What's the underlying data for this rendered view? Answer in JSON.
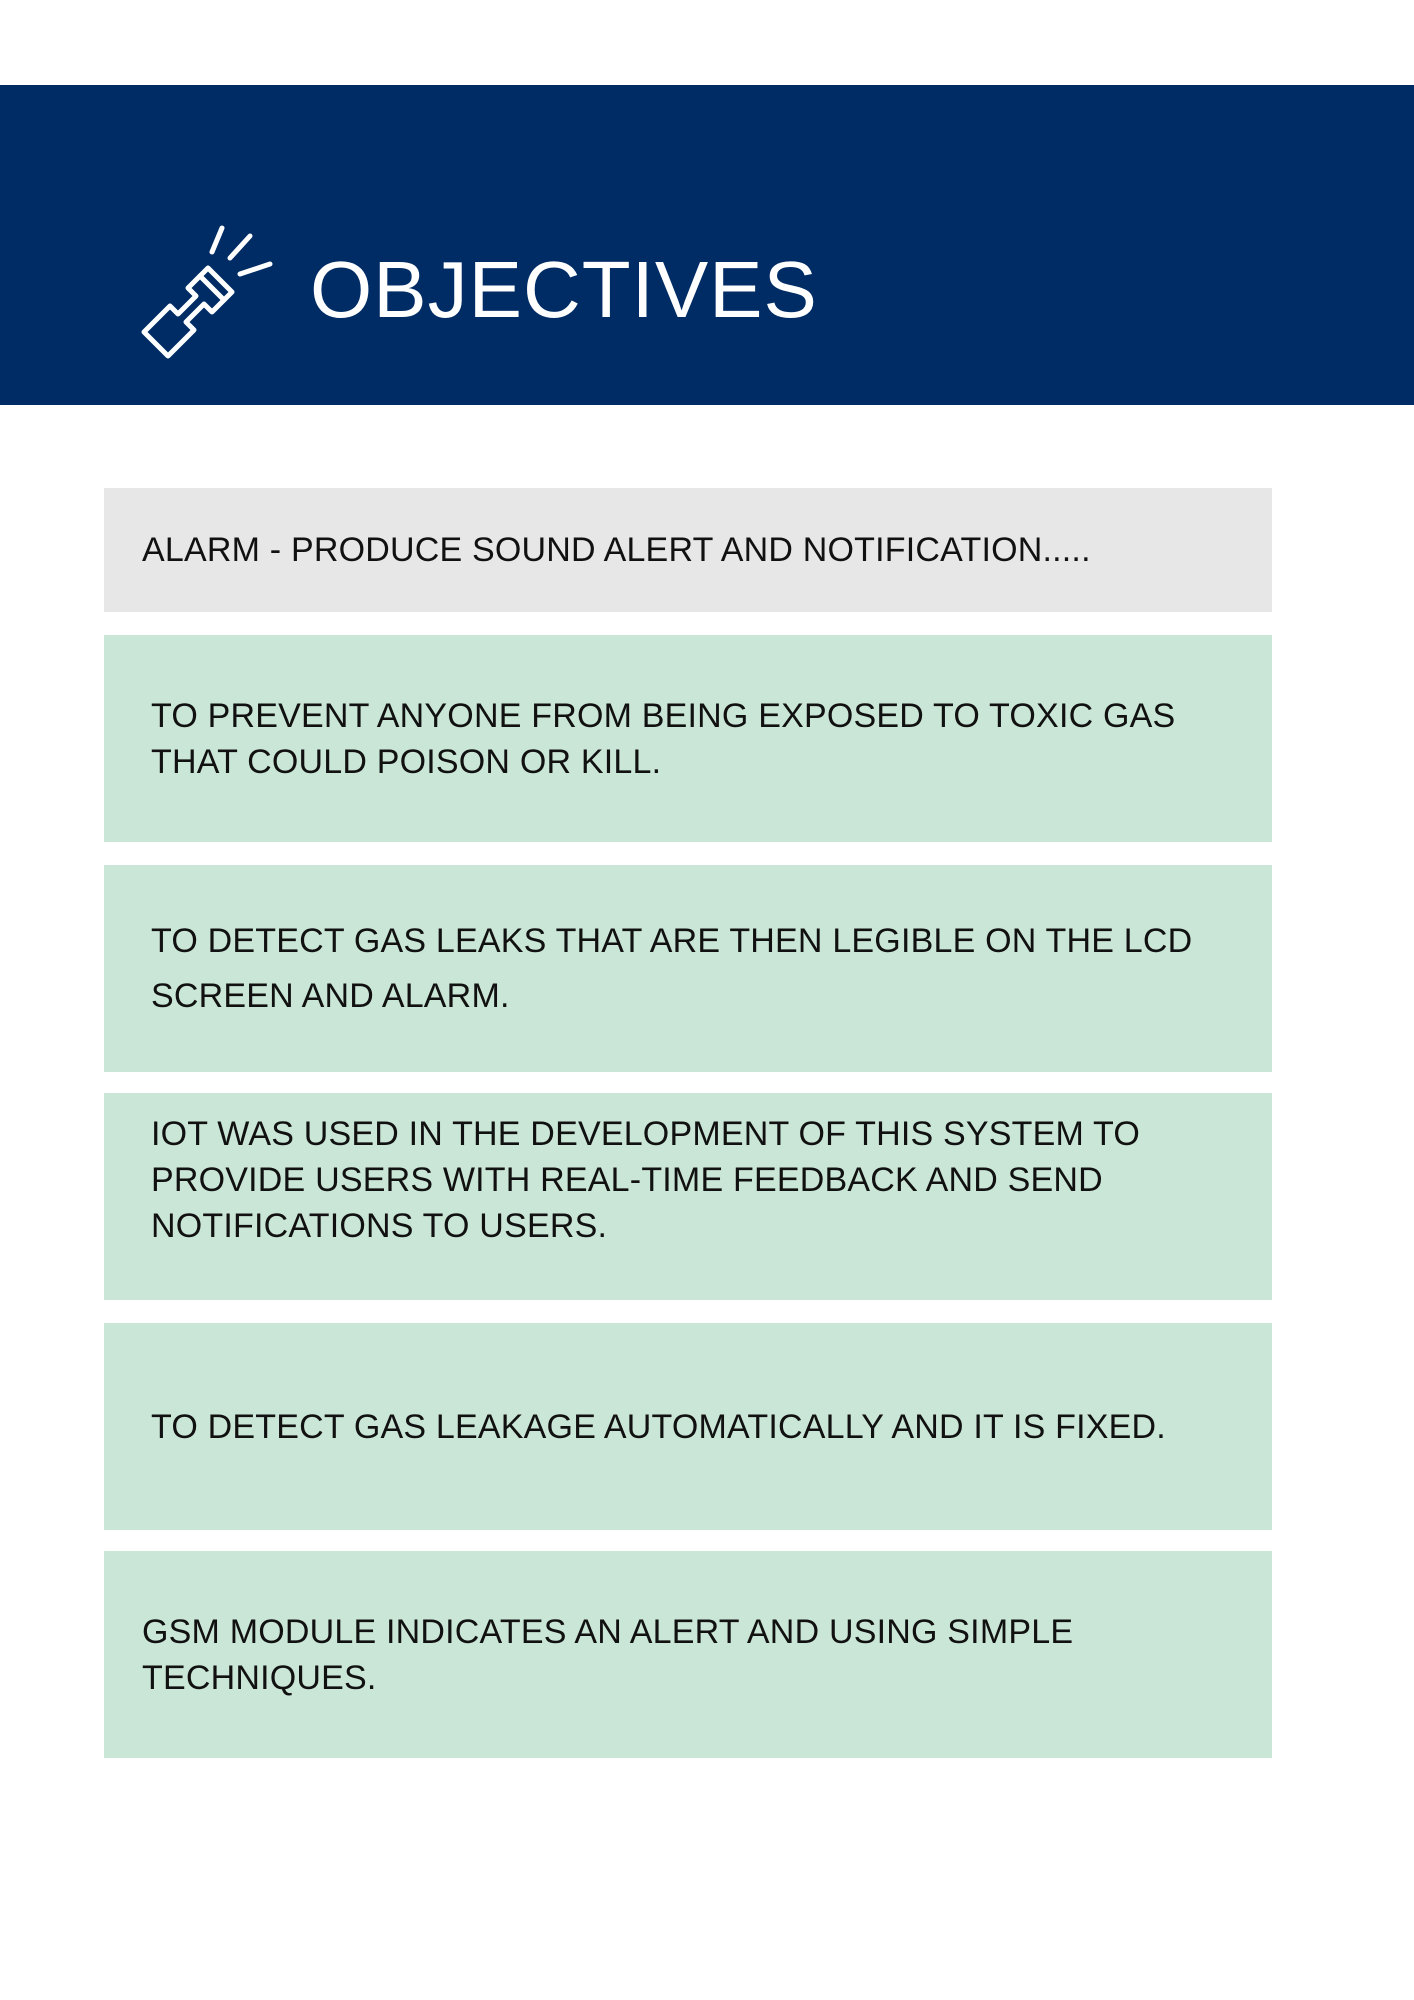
{
  "header": {
    "title": "OBJECTIVES",
    "icon": "flashlight-icon",
    "background": "#002c66"
  },
  "objectives": [
    {
      "text": "ALARM - PRODUCE SOUND ALERT AND NOTIFICATION....."
    },
    {
      "text": "TO PREVENT ANYONE FROM BEING EXPOSED TO TOXIC GAS THAT COULD POISON OR KILL."
    },
    {
      "text": "TO DETECT GAS LEAKS THAT ARE THEN LEGIBLE ON THE LCD SCREEN AND ALARM."
    },
    {
      "text": "IOT WAS USED IN THE DEVELOPMENT OF THIS SYSTEM TO PROVIDE USERS WITH REAL-TIME FEEDBACK AND SEND NOTIFICATIONS TO USERS."
    },
    {
      "text": "TO DETECT GAS LEAKAGE AUTOMATICALLY AND IT IS FIXED."
    },
    {
      "text": "GSM MODULE INDICATES AN ALERT AND USING SIMPLE TECHNIQUES."
    }
  ],
  "colors": {
    "header": "#002c66",
    "first_box": "#e7e7e7",
    "box": "#cae6d6"
  }
}
